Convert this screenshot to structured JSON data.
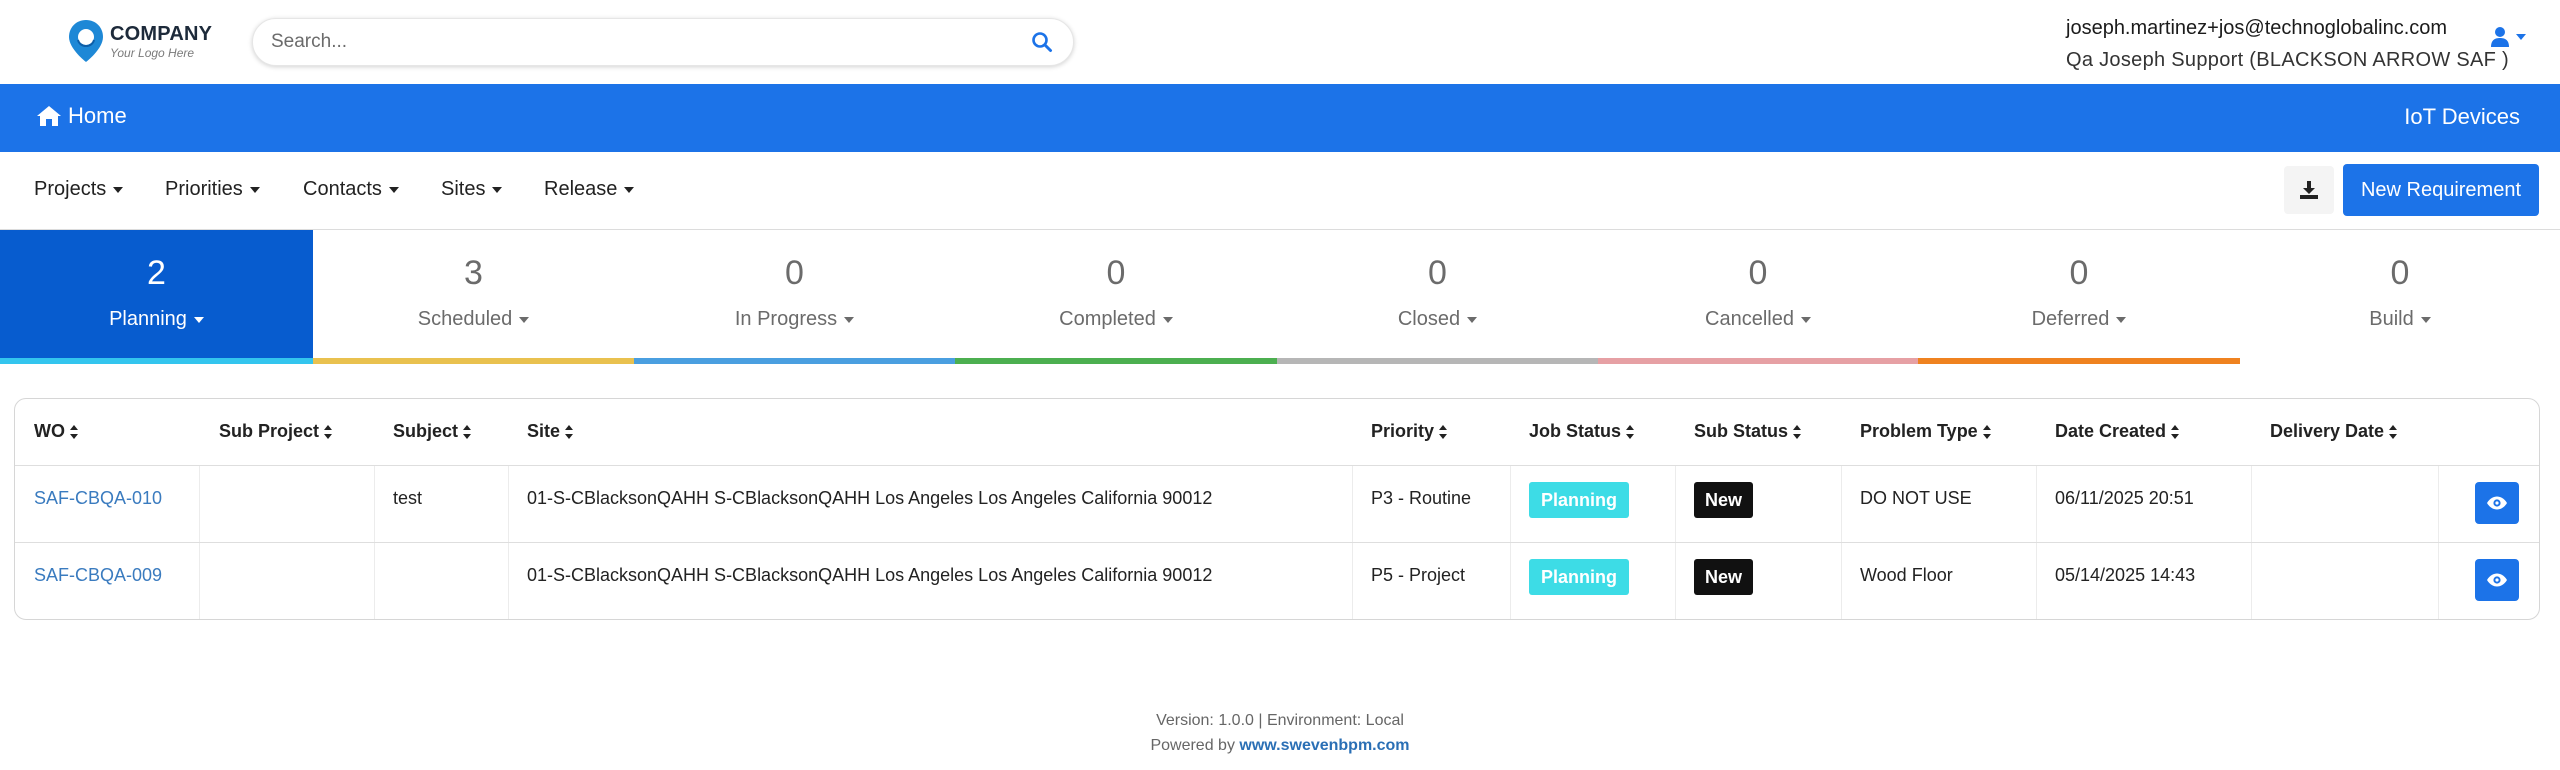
{
  "brand": {
    "name": "COMPANY",
    "tagline": "Your Logo Here",
    "logo_icon": "map-pin-icon"
  },
  "search": {
    "placeholder": "Search...",
    "icon": "search-icon"
  },
  "user": {
    "email": "joseph.martinez+jos@technoglobalinc.com",
    "role": "Qa Joseph Support (BLACKSON ARROW SAF )",
    "icon": "user-icon"
  },
  "navbar": {
    "home_label": "Home",
    "home_icon": "home-icon",
    "right_label": "IoT Devices"
  },
  "menu": {
    "items": [
      {
        "label": "Projects"
      },
      {
        "label": "Priorities"
      },
      {
        "label": "Contacts"
      },
      {
        "label": "Sites"
      },
      {
        "label": "Release"
      }
    ],
    "download_icon": "download-icon",
    "new_requirement_label": "New Requirement"
  },
  "status_tiles": [
    {
      "count": "2",
      "label": "Planning",
      "stripe": "#33c5ee",
      "active": true
    },
    {
      "count": "3",
      "label": "Scheduled",
      "stripe": "#e9c14f"
    },
    {
      "count": "0",
      "label": "In Progress",
      "stripe": "#4a9fe0"
    },
    {
      "count": "0",
      "label": "Completed",
      "stripe": "#4caf50"
    },
    {
      "count": "0",
      "label": "Closed",
      "stripe": "#b6b6b6"
    },
    {
      "count": "0",
      "label": "Cancelled",
      "stripe": "#e6a0a4"
    },
    {
      "count": "0",
      "label": "Deferred",
      "stripe": "#ef8220"
    },
    {
      "count": "0",
      "label": "Build",
      "stripe": "#ffffff"
    }
  ],
  "table": {
    "columns": [
      "WO",
      "Sub Project",
      "Subject",
      "Site",
      "Priority",
      "Job Status",
      "Sub Status",
      "Problem Type",
      "Date Created",
      "Delivery Date"
    ],
    "rows": [
      {
        "wo": "SAF-CBQA-010",
        "sub_project": "",
        "subject": "test",
        "site": "01-S-CBlacksonQAHH S-CBlacksonQAHH Los Angeles Los Angeles California 90012",
        "priority": "P3 - Routine",
        "job_status": "Planning",
        "sub_status": "New",
        "problem_type": "DO NOT USE",
        "date_created": "06/11/2025 20:51",
        "delivery_date": ""
      },
      {
        "wo": "SAF-CBQA-009",
        "sub_project": "",
        "subject": "",
        "site": "01-S-CBlacksonQAHH S-CBlacksonQAHH Los Angeles Los Angeles California 90012",
        "priority": "P5 - Project",
        "job_status": "Planning",
        "sub_status": "New",
        "problem_type": "Wood Floor",
        "date_created": "05/14/2025 14:43",
        "delivery_date": ""
      }
    ],
    "view_icon": "eye-icon"
  },
  "footer": {
    "version_line": "Version: 1.0.0 | Environment: Local",
    "powered_prefix": "Powered by",
    "powered_link": "www.swevenbpm.com"
  },
  "colors": {
    "primary": "#1c73e8",
    "active_tile": "#075ccf",
    "planning_badge": "#3ddce6",
    "new_badge": "#111111"
  }
}
